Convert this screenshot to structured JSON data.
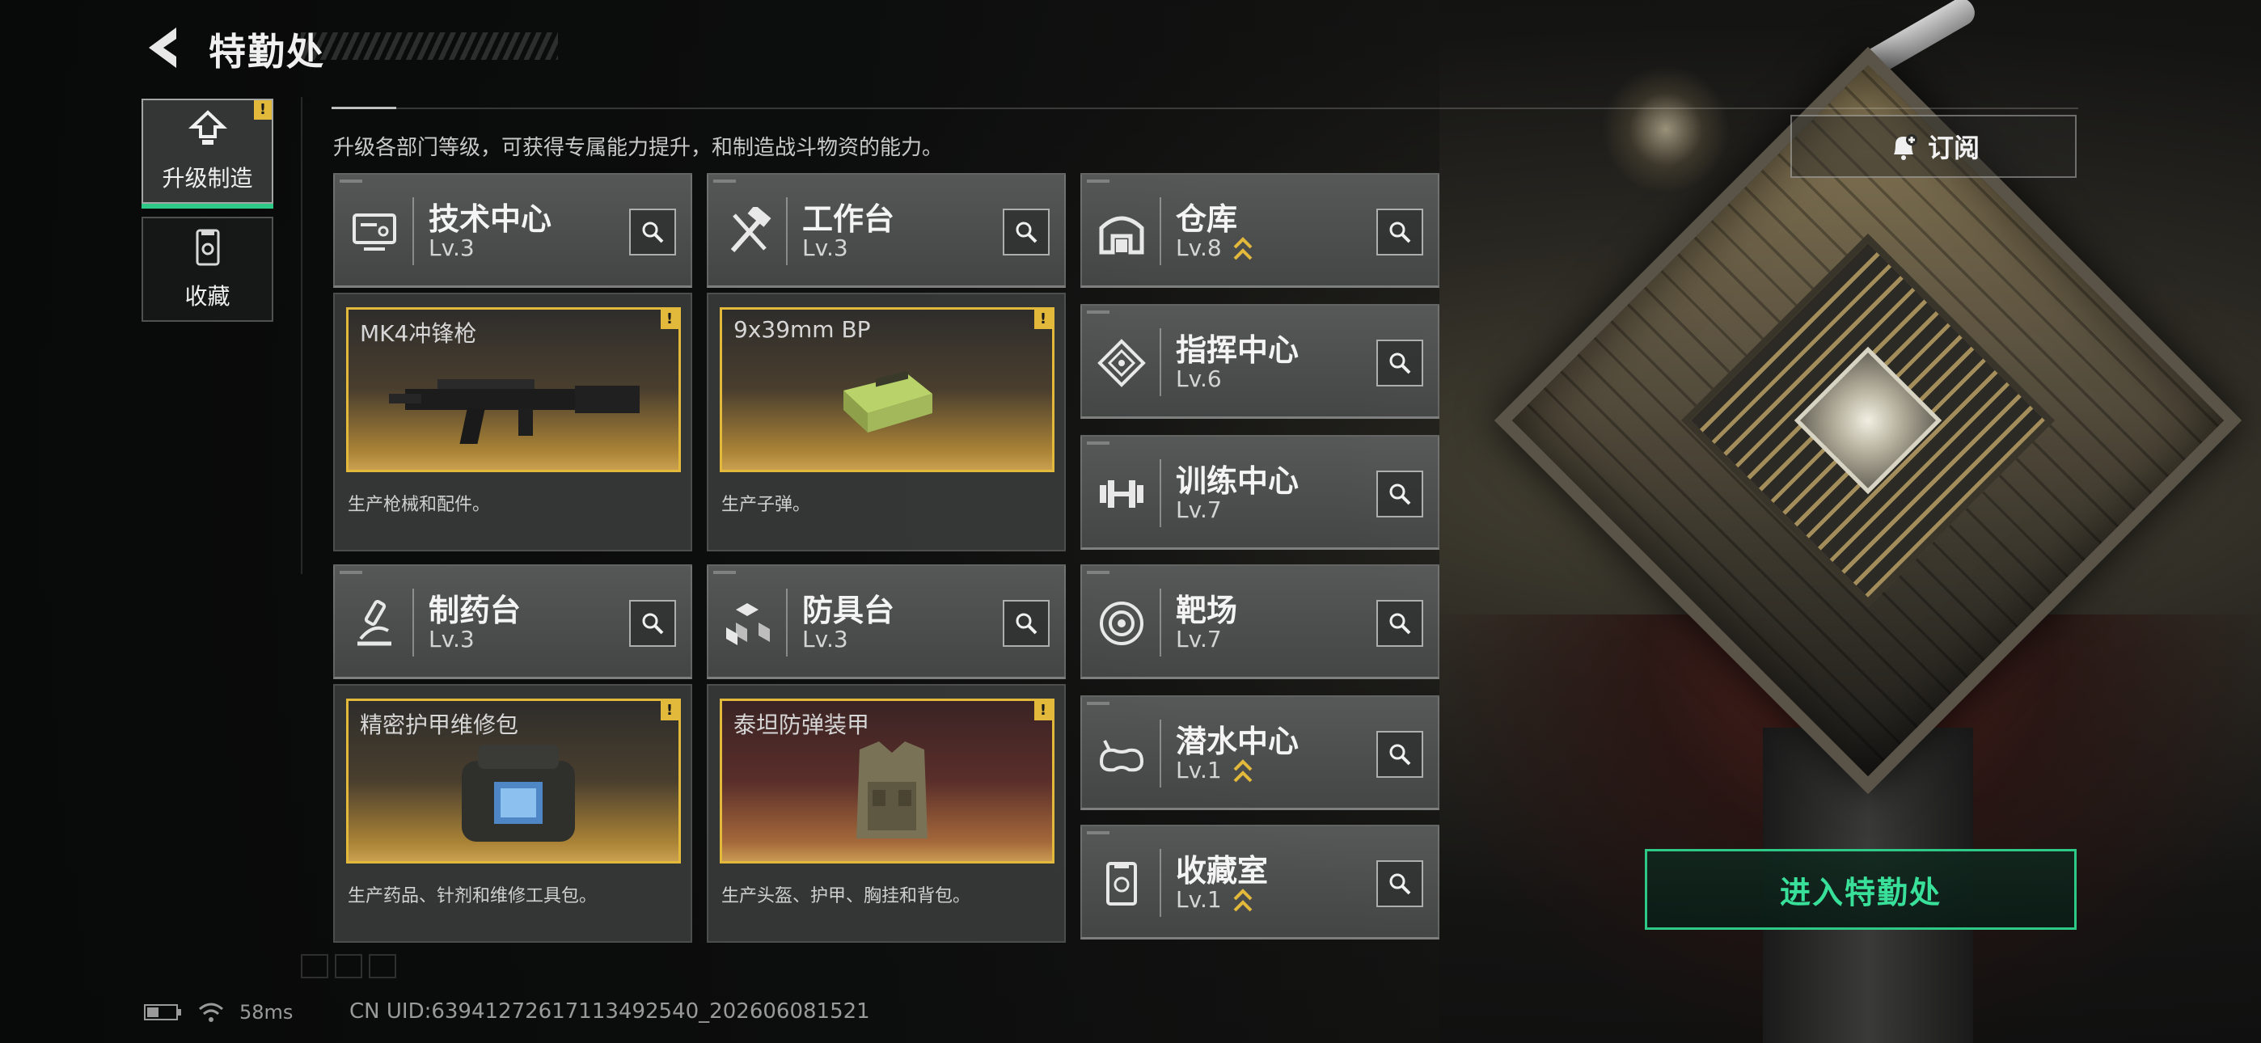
{
  "header": {
    "title": "特勤处",
    "subtitle": "升级各部门等级，可获得专属能力提升，和制造战斗物资的能力。"
  },
  "sidebar": {
    "tabs": [
      {
        "label": "升级制造",
        "active": true,
        "warning": "!"
      },
      {
        "label": "收藏",
        "active": false
      }
    ]
  },
  "departments": {
    "tech_center": {
      "name": "技术中心",
      "level": "Lv.3",
      "product": "MK4冲锋枪",
      "desc": "生产枪械和配件。",
      "warning": "!"
    },
    "workbench": {
      "name": "工作台",
      "level": "Lv.3",
      "product": "9x39mm BP",
      "desc": "生产子弹。",
      "warning": "!"
    },
    "pharmacy": {
      "name": "制药台",
      "level": "Lv.3",
      "product": "精密护甲维修包",
      "desc": "生产药品、针剂和维修工具包。",
      "warning": "!"
    },
    "armor_bench": {
      "name": "防具台",
      "level": "Lv.3",
      "product": "泰坦防弹装甲",
      "desc": "生产头盔、护甲、胸挂和背包。",
      "warning": "!"
    },
    "warehouse": {
      "name": "仓库",
      "level": "Lv.8",
      "upgradable": true
    },
    "command_center": {
      "name": "指挥中心",
      "level": "Lv.6",
      "upgradable": false
    },
    "training_center": {
      "name": "训练中心",
      "level": "Lv.7",
      "upgradable": false
    },
    "shooting_range": {
      "name": "靶场",
      "level": "Lv.7",
      "upgradable": false
    },
    "diving_center": {
      "name": "潜水中心",
      "level": "Lv.1",
      "upgradable": true
    },
    "collection_room": {
      "name": "收藏室",
      "level": "Lv.1",
      "upgradable": true
    }
  },
  "actions": {
    "subscribe_label": "订阅",
    "enter_label": "进入特勤处"
  },
  "status": {
    "ping": "58ms",
    "uid": "CN UID:63941272617113492540_202606081521"
  },
  "colors": {
    "accent_green": "#2ec987",
    "warning_yellow": "#e2b93b",
    "upgrade_chevron": "#e2b93b"
  }
}
